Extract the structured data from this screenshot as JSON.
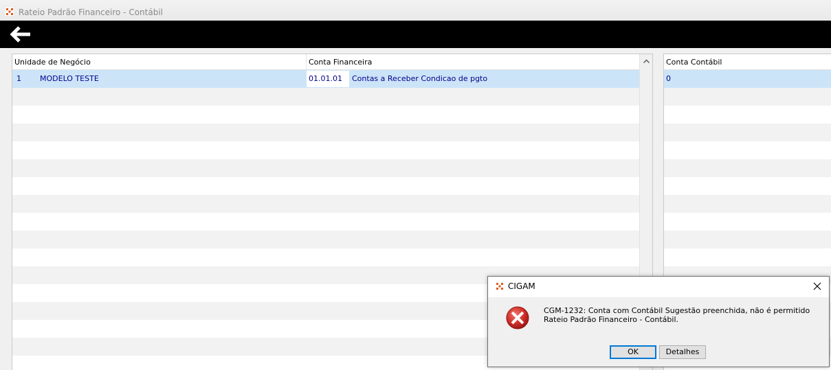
{
  "window": {
    "title": "Rateio Padrão Financeiro - Contábil"
  },
  "toolbar": {
    "back_icon": "arrow-left-icon"
  },
  "left_grid": {
    "columns": [
      "Unidade de Negócio",
      "Conta Financeira"
    ],
    "rows": [
      {
        "unidade_code": "1",
        "unidade_name": "MODELO TESTE",
        "conta_code": "01.01.01",
        "conta_desc": "Contas a Receber Condicao de pgto"
      }
    ]
  },
  "right_grid": {
    "columns": [
      "Conta Contábil"
    ],
    "rows": [
      {
        "conta_contabil": "0"
      }
    ]
  },
  "dialog": {
    "title": "CIGAM",
    "message": "CGM-1232: Conta com Contábil Sugestão preenchida, não é permitido Rateio Padrão Financeiro - Contábil.",
    "ok_label": "OK",
    "details_label": "Detalhes",
    "icon": "error-icon"
  },
  "colors": {
    "selected_row": "#cce4f7",
    "alt_row": "#f2f2f2",
    "cell_text": "#00008b",
    "toolbar": "#000000",
    "app_icon": "#e05a1a"
  }
}
